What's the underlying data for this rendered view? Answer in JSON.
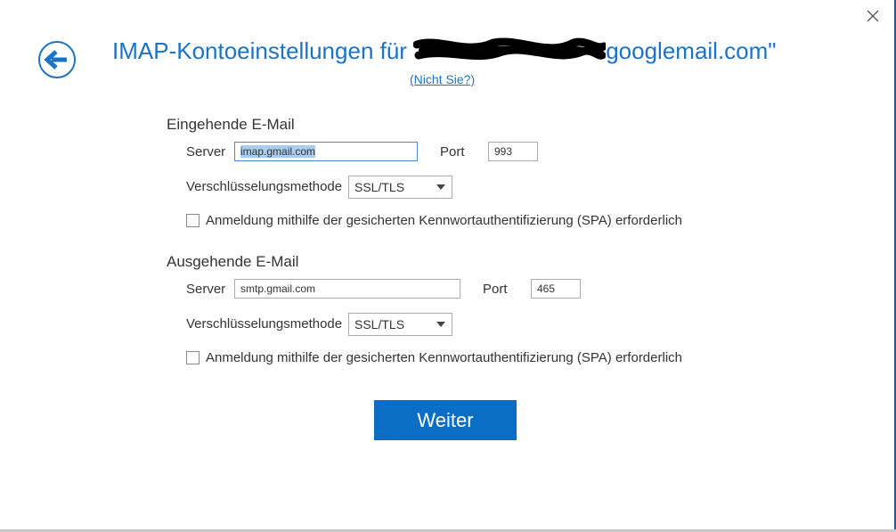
{
  "header": {
    "title_prefix": "IMAP-Kontoeinstellungen für ",
    "title_suffix": "googlemail.com\"",
    "not_you_link": "(Nicht Sie?)"
  },
  "incoming": {
    "section_title": "Eingehende E-Mail",
    "server_label": "Server",
    "server_value": "imap.gmail.com",
    "port_label": "Port",
    "port_value": "993",
    "encryption_label": "Verschlüsselungsmethode",
    "encryption_value": "SSL/TLS",
    "spa_label": "Anmeldung mithilfe der gesicherten Kennwortauthentifizierung (SPA) erforderlich"
  },
  "outgoing": {
    "section_title": "Ausgehende E-Mail",
    "server_label": "Server",
    "server_value": "smtp.gmail.com",
    "port_label": "Port",
    "port_value": "465",
    "encryption_label": "Verschlüsselungsmethode",
    "encryption_value": "SSL/TLS",
    "spa_label": "Anmeldung mithilfe der gesicherten Kennwortauthentifizierung (SPA) erforderlich"
  },
  "actions": {
    "next_label": "Weiter"
  },
  "icons": {
    "back": "back-arrow-icon",
    "close": "close-icon",
    "dropdown": "chevron-down-icon"
  },
  "colors": {
    "accent": "#1a73c8",
    "button": "#0a6ec4",
    "selection": "#a7cdf0"
  }
}
